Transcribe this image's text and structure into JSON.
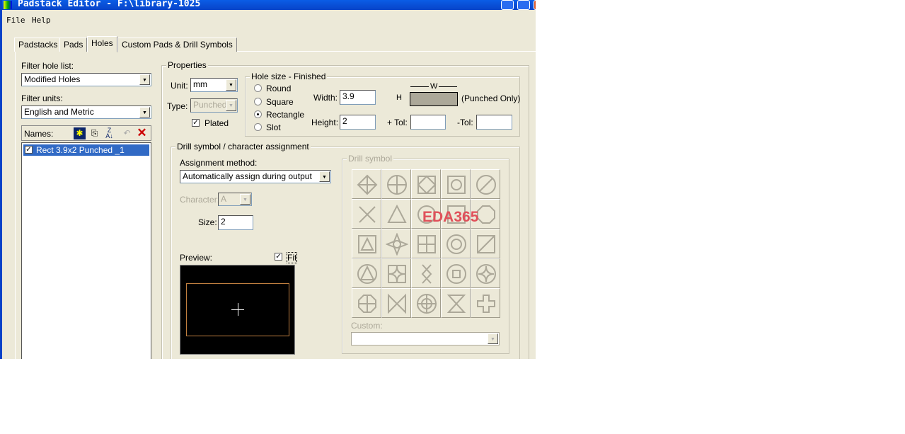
{
  "window": {
    "title": "Padstack Editor - F:\\library-1025"
  },
  "menu": [
    "File",
    "Help"
  ],
  "tabs": [
    "Padstacks",
    "Pads",
    "Holes",
    "Custom Pads & Drill Symbols"
  ],
  "active_tab": "Holes",
  "left": {
    "filter_hole_label": "Filter hole list:",
    "filter_hole_value": "Modified Holes",
    "filter_units_label": "Filter units:",
    "filter_units_value": "English and Metric",
    "names_label": "Names:",
    "list": [
      {
        "label": "Rect 3.9x2 Punched _1",
        "checked": true,
        "selected": true
      }
    ]
  },
  "properties": {
    "title": "Properties",
    "unit_label": "Unit:",
    "unit_value": "mm",
    "type_label": "Type:",
    "type_value": "Punched",
    "plated_label": "Plated",
    "plated": true,
    "hole_size": {
      "title": "Hole size - Finished",
      "shapes": [
        "Round",
        "Square",
        "Rectangle",
        "Slot"
      ],
      "selected": "Rectangle",
      "width_label": "Width:",
      "width_value": "3.9",
      "height_label": "Height:",
      "height_value": "2",
      "ptol_label": "+ Tol:",
      "ptol_value": "",
      "ntol_label": "-Tol:",
      "ntol_value": "",
      "w_mark": "W",
      "h_mark": "H",
      "punched_only": "(Punched Only)"
    }
  },
  "drill": {
    "title": "Drill symbol / character assignment",
    "method_label": "Assignment method:",
    "method_value": "Automatically assign during output",
    "character_label": "Character:",
    "character_value": "A",
    "size_label": "Size:",
    "size_value": "2",
    "preview_label": "Preview:",
    "fit_label": "Fit",
    "fit": true,
    "symbol_title": "Drill symbol",
    "custom_label": "Custom:",
    "custom_value": "",
    "watermark": "EDA365",
    "symbols": [
      "diamond-cross",
      "circle-cross",
      "square-diamond",
      "square-circle",
      "circle-slash",
      "x",
      "triangle",
      "circle",
      "square",
      "octagon",
      "square-triangle",
      "star-circle",
      "square-cross",
      "double-circle",
      "square-slash",
      "circle-triangle",
      "square-star",
      "hourglass-vertical",
      "circle-square",
      "circle-star",
      "octagon-cross",
      "bowtie",
      "target",
      "hourglass",
      "plus"
    ]
  },
  "colors": {
    "title_bar": "#0a5de6",
    "selection": "#316ac5",
    "preview_bg": "#000000",
    "preview_outline": "#c08040",
    "watermark": "#e0505a"
  }
}
